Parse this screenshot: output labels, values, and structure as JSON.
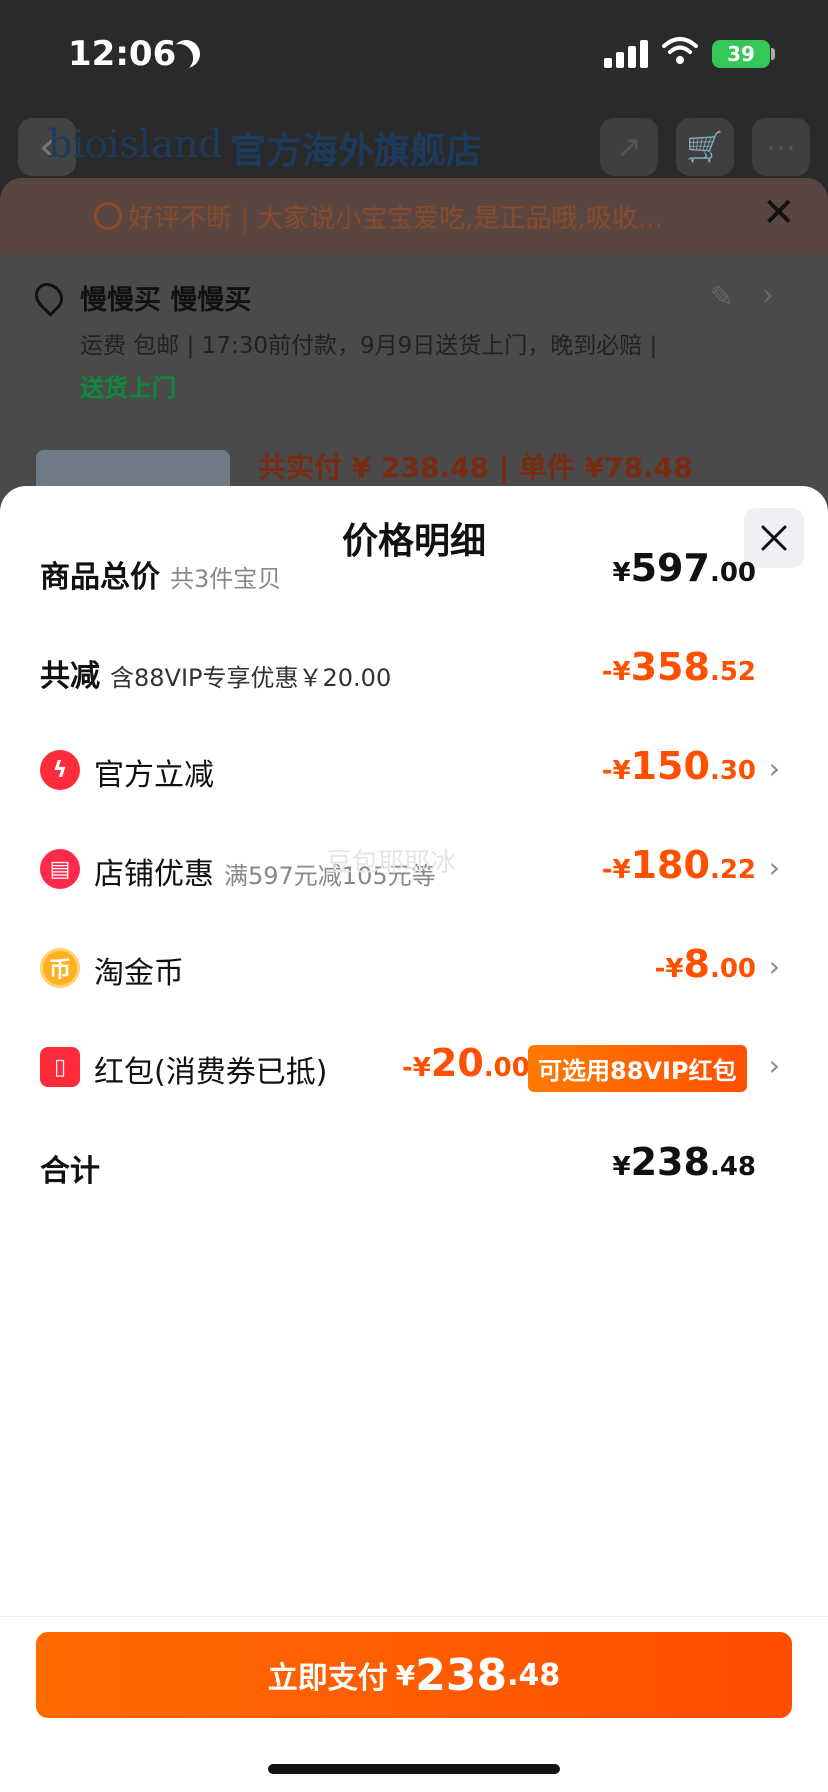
{
  "status_bar": {
    "time": "12:06",
    "battery": "39"
  },
  "store": {
    "brand": "bioisland",
    "name": "官方海外旗舰店"
  },
  "notice": {
    "text": "好评不断 | 大家说小宝宝爱吃,是正品哦,吸收..."
  },
  "address": {
    "name": "慢慢买 慢慢买",
    "shipping": "运费 包邮 | 17:30前付款，9月9日送货上门，晚到必赔 |",
    "delivery_link": "送货上门"
  },
  "preview": {
    "pay_text": "共实付 ¥ 238.48 | 单件 ¥78.48"
  },
  "sheet": {
    "title": "价格明细",
    "rows": {
      "total": {
        "label": "商品总价",
        "sub": "共3件宝贝",
        "yen": "¥",
        "int": "597",
        "dec": ".00"
      },
      "reduce": {
        "label": "共减",
        "sub": "含88VIP专享优惠￥20.00",
        "yen": "-¥",
        "int": "358",
        "dec": ".52"
      },
      "official": {
        "label": "官方立减",
        "yen": "-¥",
        "int": "150",
        "dec": ".30"
      },
      "shop": {
        "label": "店铺优惠",
        "sub": "满597元减105元等",
        "yen": "-¥",
        "int": "180",
        "dec": ".22"
      },
      "coin": {
        "label": "淘金币",
        "yen": "-¥",
        "int": "8",
        "dec": ".00"
      },
      "hongbao": {
        "label": "红包(消费券已抵)",
        "yen": "-¥",
        "int": "20",
        "dec": ".00",
        "tag": "可选用88VIP红包"
      },
      "sum": {
        "label": "合计",
        "yen": "¥",
        "int": "238",
        "dec": ".48"
      }
    },
    "watermark": "豆包耶耶冰"
  },
  "pay_button": {
    "label": "立即支付",
    "yen": "¥",
    "int": "238",
    "dec": ".48"
  },
  "colors": {
    "accent": "#ff5000",
    "text": "#111111",
    "muted": "#888888"
  }
}
